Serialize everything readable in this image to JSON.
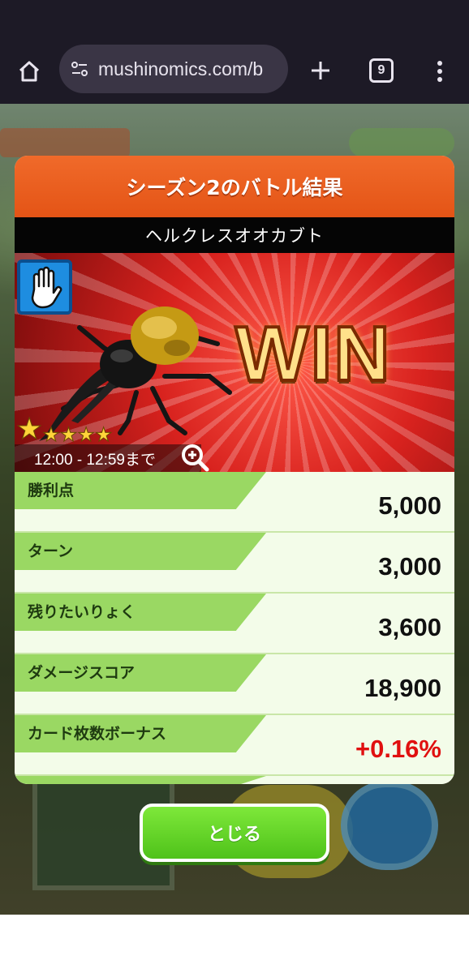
{
  "browser": {
    "url_text": "mushinomics.com/b",
    "tab_count": "9",
    "icons": [
      "home-icon",
      "site-settings-icon",
      "new-tab-plus-icon",
      "tab-switcher-icon",
      "more-menu-icon"
    ]
  },
  "dialog": {
    "title": "シーズン2のバトル結果",
    "subtitle": "ヘルクレスオオカブト",
    "banner": {
      "result": "WIN",
      "time_range": "12:00 - 12:59まで",
      "stars": {
        "filled": 1,
        "total": 5
      },
      "badge_icon": "hand-icon",
      "zoom_icon": "zoom-in-icon"
    },
    "rows": [
      {
        "label": "勝利点",
        "value": "5,000"
      },
      {
        "label": "ターン",
        "value": "3,000"
      },
      {
        "label": "残りたいりょく",
        "value": "3,600"
      },
      {
        "label": "ダメージスコア",
        "value": "18,900"
      },
      {
        "label": "カード枚数ボーナス",
        "value": "+0.16%"
      }
    ],
    "colors": {
      "header": "#e45416",
      "row_label": "#9ad863",
      "bonus_value": "#e01010",
      "close_button": "#5fd324"
    }
  },
  "close_button": {
    "label": "とじる"
  }
}
